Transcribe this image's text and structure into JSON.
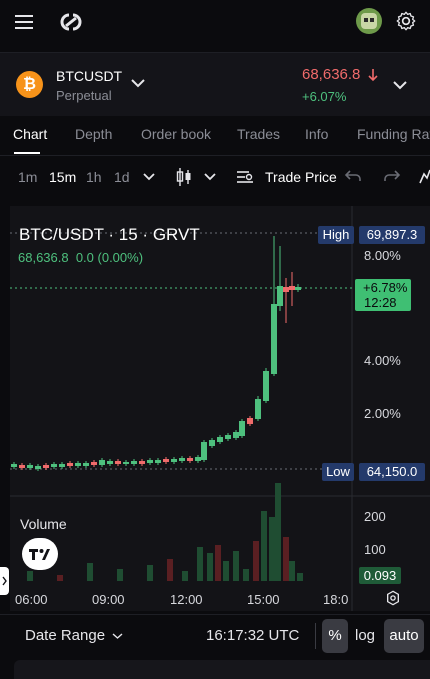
{
  "pair": {
    "symbol": "BTCUSDT",
    "type": "Perpetual",
    "price": "68,636.8",
    "change_pct": "+6.07%"
  },
  "tabs": [
    "Chart",
    "Depth",
    "Order book",
    "Trades",
    "Info",
    "Funding Rate"
  ],
  "toolbar": {
    "intervals": [
      "1m",
      "15m",
      "1h",
      "1d"
    ],
    "active_interval": "15m",
    "price_source": "Trade Price"
  },
  "chart": {
    "title": "BTC/USDT · 15 · GRVT",
    "ohlc_line": "68,636.8  0.0 (0.00%)",
    "high_label": "High",
    "high_value": "69,897.3",
    "low_label": "Low",
    "low_value": "64,150.0",
    "current_change": "+6.78%",
    "countdown": "12:28",
    "volume_label": "Volume",
    "volume_value": "0.093",
    "pct_ticks": [
      "8.00%",
      "4.00%",
      "2.00%"
    ],
    "vol_ticks": [
      "200",
      "100"
    ],
    "time_ticks": [
      "06:00",
      "09:00",
      "12:00",
      "15:00",
      "18:0"
    ]
  },
  "bottom": {
    "date_range": "Date Range",
    "clock": "16:17:32 UTC",
    "percent_btn": "%",
    "log_btn": "log",
    "auto_btn": "auto"
  },
  "colors": {
    "up": "#4ec07e",
    "down": "#f06b6b",
    "accent_btc": "#f7931a",
    "label_bg": "#243a6b"
  }
}
